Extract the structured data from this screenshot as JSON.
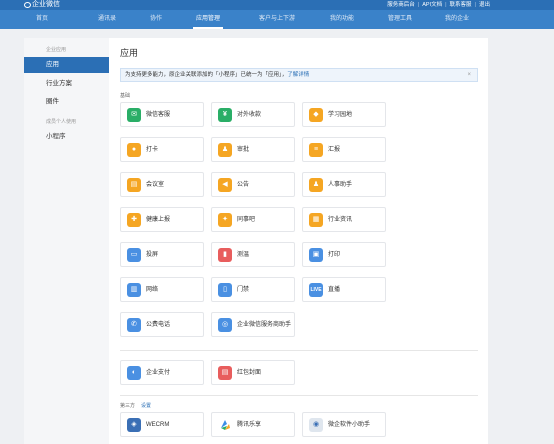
{
  "header": {
    "brand": "企业微信",
    "links": [
      "服务商后台",
      "API文档",
      "联系客服",
      "退出"
    ]
  },
  "nav": {
    "items": [
      "首页",
      "通讯录",
      "协作",
      "应用管理",
      "客户与上下游",
      "我的功能",
      "管理工具",
      "我的企业"
    ],
    "active": "应用管理"
  },
  "sidebar": {
    "group1": "企业应用",
    "app_item": "应用",
    "industry_item": "行业方案",
    "team_item": "圈件",
    "group2": "成员个人使用",
    "miniapp_item": "小程序"
  },
  "main": {
    "title": "应用",
    "notice": "为支持更多能力，原企业关联添加的「小程序」已统一为「应用」，",
    "notice_link": "了解详情",
    "notice_close": "×",
    "section_basic": "基础",
    "section_third": "第三方",
    "section_third_link": "设置",
    "apps": [
      {
        "label": "微信客服",
        "icon": "customer-service-icon",
        "color": "#2aae67",
        "glyph": "✉"
      },
      {
        "label": "对外收款",
        "icon": "payment-icon",
        "color": "#2aae67",
        "glyph": "¥"
      },
      {
        "label": "学习园地",
        "icon": "learning-icon",
        "color": "#f5a623",
        "glyph": "◆"
      },
      {
        "label": "打卡",
        "icon": "checkin-icon",
        "color": "#f5a623",
        "glyph": "●"
      },
      {
        "label": "审批",
        "icon": "approval-icon",
        "color": "#f5a623",
        "glyph": "♟"
      },
      {
        "label": "汇报",
        "icon": "report-icon",
        "color": "#f5a623",
        "glyph": "≡"
      },
      {
        "label": "会议室",
        "icon": "meeting-room-icon",
        "color": "#f5a623",
        "glyph": "▤"
      },
      {
        "label": "公告",
        "icon": "announcement-icon",
        "color": "#f5a623",
        "glyph": "◀"
      },
      {
        "label": "人事助手",
        "icon": "hr-icon",
        "color": "#f5a623",
        "glyph": "♟"
      },
      {
        "label": "健康上报",
        "icon": "health-report-icon",
        "color": "#f5a623",
        "glyph": "✚"
      },
      {
        "label": "同事吧",
        "icon": "colleague-icon",
        "color": "#f5a623",
        "glyph": "✦"
      },
      {
        "label": "行业资讯",
        "icon": "industry-news-icon",
        "color": "#f5a623",
        "glyph": "▦"
      },
      {
        "label": "投屏",
        "icon": "screen-cast-icon",
        "color": "#4a90e2",
        "glyph": "▭"
      },
      {
        "label": "测温",
        "icon": "thermometer-icon",
        "color": "#e85d5d",
        "glyph": "▮"
      },
      {
        "label": "打印",
        "icon": "print-icon",
        "color": "#4a90e2",
        "glyph": "▣"
      },
      {
        "label": "网络",
        "icon": "network-icon",
        "color": "#4a90e2",
        "glyph": "▥"
      },
      {
        "label": "门禁",
        "icon": "access-control-icon",
        "color": "#4a90e2",
        "glyph": "▯"
      },
      {
        "label": "直播",
        "icon": "live-icon",
        "color": "#4a90e2",
        "glyph": "LIVE"
      },
      {
        "label": "公费电话",
        "icon": "phone-icon",
        "color": "#4a90e2",
        "glyph": "✆"
      },
      {
        "label": "企业微信服务商助手",
        "icon": "provider-assistant-icon",
        "color": "#4a90e2",
        "glyph": "◎"
      },
      {
        "label": "企业支付",
        "icon": "enterprise-pay-icon",
        "color": "#4a90e2",
        "glyph": "◐"
      },
      {
        "label": "红包封面",
        "icon": "red-packet-icon",
        "color": "#e85d5d",
        "glyph": "▤"
      },
      {
        "label": "WECRM",
        "icon": "wecrm-icon",
        "color": "#3a6fb5",
        "glyph": "◈"
      },
      {
        "label": "腾讯乐享",
        "icon": "tencent-lexiang-icon",
        "color": "#ffffff",
        "glyph": ""
      },
      {
        "label": "微企软件小助手",
        "icon": "software-helper-icon",
        "color": "#dfe6ee",
        "glyph": "◉"
      }
    ]
  }
}
